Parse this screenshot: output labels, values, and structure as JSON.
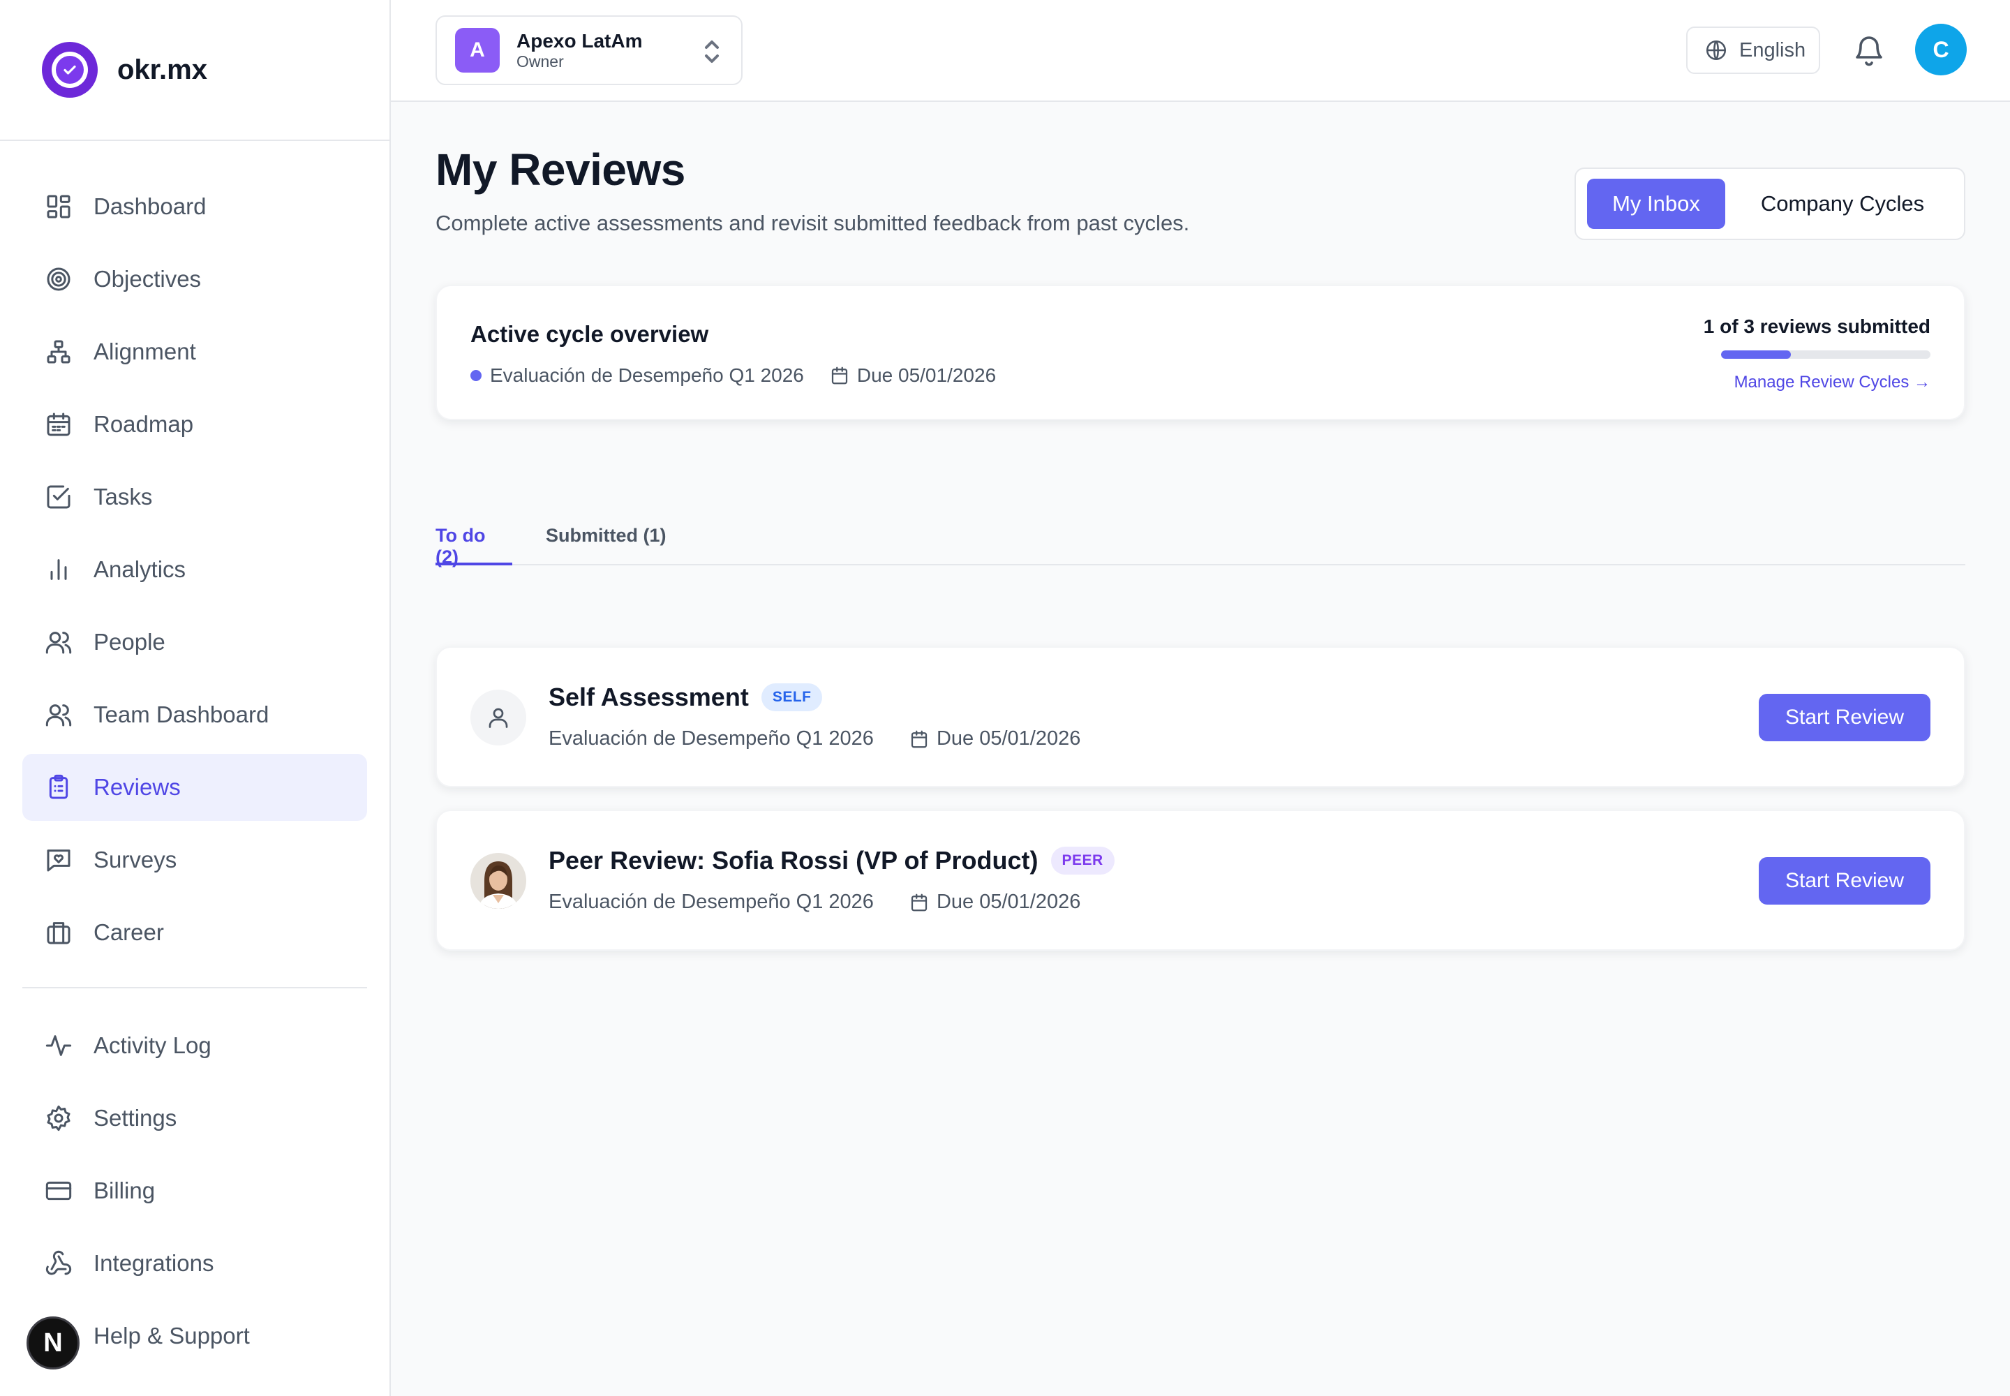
{
  "brand": {
    "name": "okr.mx"
  },
  "sidebar": {
    "primary": [
      {
        "label": "Dashboard",
        "icon": "layout-grid-icon"
      },
      {
        "label": "Objectives",
        "icon": "target-icon"
      },
      {
        "label": "Alignment",
        "icon": "hierarchy-icon"
      },
      {
        "label": "Roadmap",
        "icon": "calendar-icon"
      },
      {
        "label": "Tasks",
        "icon": "checkbox-icon"
      },
      {
        "label": "Analytics",
        "icon": "bar-chart-icon"
      },
      {
        "label": "People",
        "icon": "users-icon"
      },
      {
        "label": "Team Dashboard",
        "icon": "users-icon"
      },
      {
        "label": "Reviews",
        "icon": "clipboard-icon",
        "active": true
      },
      {
        "label": "Surveys",
        "icon": "message-heart-icon"
      },
      {
        "label": "Career",
        "icon": "briefcase-icon"
      }
    ],
    "secondary": [
      {
        "label": "Activity Log",
        "icon": "activity-icon"
      },
      {
        "label": "Settings",
        "icon": "gear-icon"
      },
      {
        "label": "Billing",
        "icon": "credit-card-icon"
      },
      {
        "label": "Integrations",
        "icon": "webhook-icon"
      },
      {
        "label": "Help & Support",
        "icon": "help-circle-icon"
      }
    ],
    "dev_badge": "N"
  },
  "header": {
    "org": {
      "initial": "A",
      "name": "Apexo LatAm",
      "role": "Owner"
    },
    "language": "English",
    "user_initial": "C"
  },
  "page": {
    "title": "My Reviews",
    "subtitle": "Complete active assessments and revisit submitted feedback from past cycles.",
    "segments": {
      "inbox": "My Inbox",
      "company": "Company Cycles"
    }
  },
  "overview": {
    "title": "Active cycle overview",
    "cycle": "Evaluación de Desempeño Q1 2026",
    "due": "Due 05/01/2026",
    "count": "1 of 3 reviews submitted",
    "progress": 0.3333,
    "link": "Manage Review Cycles →"
  },
  "tabs": {
    "todo": "To do (2)",
    "submitted": "Submitted (1)"
  },
  "reviews": [
    {
      "title": "Self Assessment",
      "badge": "SELF",
      "cycle": "Evaluación de Desempeño Q1 2026",
      "due": "Due 05/01/2026",
      "action": "Start Review"
    },
    {
      "title": "Peer Review: Sofia Rossi (VP of Product)",
      "badge": "PEER",
      "cycle": "Evaluación de Desempeño Q1 2026",
      "due": "Due 05/01/2026",
      "action": "Start Review"
    }
  ],
  "colors": {
    "accent": "#6366f1",
    "brand": "#6d28d9",
    "avatar": "#0ea5e9"
  }
}
